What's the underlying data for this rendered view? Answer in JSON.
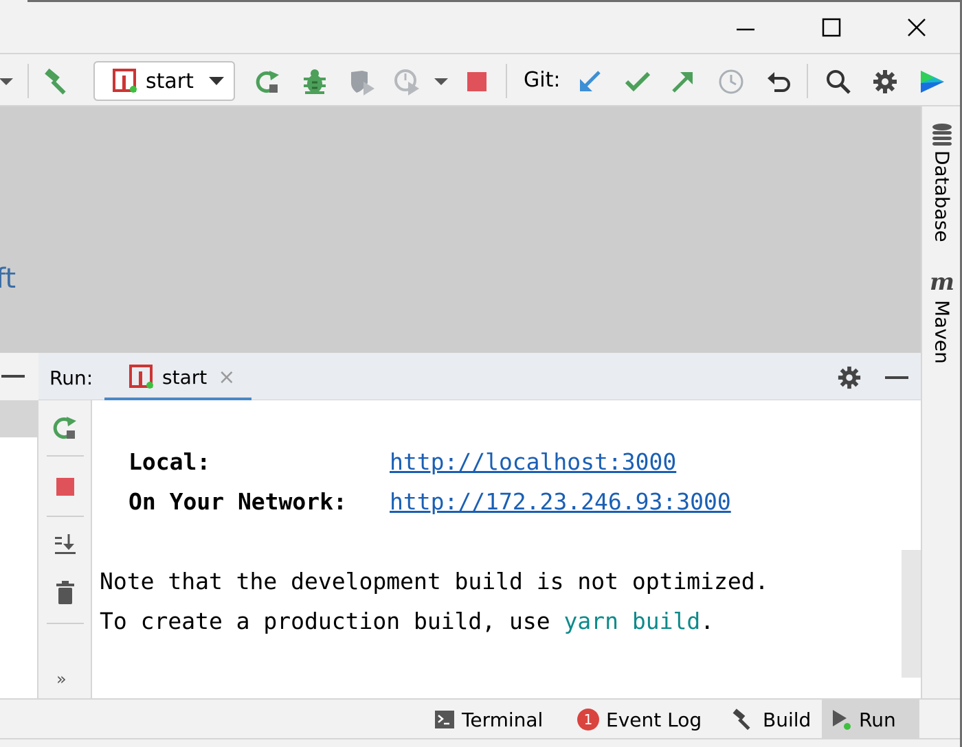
{
  "window_controls": {
    "minimize_icon": "minimize-icon",
    "maximize_icon": "maximize-icon",
    "close_icon": "close-icon"
  },
  "toolbar": {
    "run_config_label": "start",
    "git_label": "Git:",
    "icons": [
      "back-arrow-icon",
      "build-hammer-icon",
      "npm-icon",
      "rerun-icon",
      "debug-bug-icon",
      "coverage-icon",
      "profile-icon",
      "dropdown-icon",
      "stop-icon",
      "git-update-icon",
      "git-commit-icon",
      "git-push-icon",
      "git-history-icon",
      "git-rollback-icon",
      "search-icon",
      "settings-gear-icon",
      "toolbox-logo-icon"
    ]
  },
  "editor": {
    "partial_text": "ft"
  },
  "right_stripe": {
    "database_label": "Database",
    "maven_label": "Maven",
    "maven_glyph": "m"
  },
  "run_panel": {
    "title": "Run:",
    "tab_label": "start",
    "tab_close": "×"
  },
  "console": {
    "local_label": "Local:",
    "local_url": "http://localhost:3000",
    "network_label": "On Your Network:",
    "network_url": "http://172.23.246.93:3000",
    "note_line": "Note that the development build is not optimized.",
    "prod_prefix": "To create a production build, use ",
    "prod_cmd": "yarn build",
    "prod_suffix": "."
  },
  "side_toolbar": {
    "more": "»"
  },
  "bottom_bar": {
    "terminal": "Terminal",
    "event_log": "Event Log",
    "event_log_count": "1",
    "build": "Build",
    "run": "Run"
  },
  "colors": {
    "accent_blue": "#4a88c7",
    "link": "#1a5fb4",
    "green": "#4ca05a",
    "stop_red": "#e0525a",
    "badge_red": "#d9443f",
    "command_teal": "#0f8a8a"
  }
}
